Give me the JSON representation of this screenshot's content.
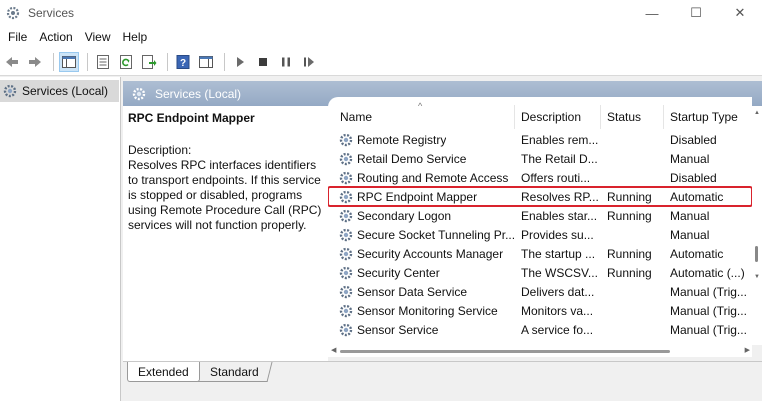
{
  "window": {
    "title": "Services",
    "controls": {
      "minimize": "—",
      "maximize": "☐",
      "close": "✕"
    }
  },
  "menu": [
    "File",
    "Action",
    "View",
    "Help"
  ],
  "toolbar": {
    "icons": [
      "back-arrow-icon",
      "forward-arrow-icon",
      "show-hide-console-tree-icon",
      "properties-icon",
      "refresh-icon",
      "export-list-icon",
      "help-icon",
      "action-pane-icon",
      "start-service-icon",
      "stop-service-icon",
      "pause-service-icon",
      "restart-service-icon"
    ]
  },
  "tree": {
    "item": "Services (Local)"
  },
  "pane": {
    "title": "Services (Local)"
  },
  "description": {
    "service_name": "RPC Endpoint Mapper",
    "label": "Description:",
    "text": "Resolves RPC interfaces identifiers to transport endpoints. If this service is stopped or disabled, programs using Remote Procedure Call (RPC) services will not function properly."
  },
  "list": {
    "columns": {
      "name": "Name",
      "description": "Description",
      "status": "Status",
      "startup": "Startup Type"
    },
    "sort_arrow": "^",
    "rows": [
      {
        "name": "Remote Registry",
        "description": "Enables rem...",
        "status": "",
        "startup": "Disabled"
      },
      {
        "name": "Retail Demo Service",
        "description": "The Retail D...",
        "status": "",
        "startup": "Manual"
      },
      {
        "name": "Routing and Remote Access",
        "description": "Offers routi...",
        "status": "",
        "startup": "Disabled"
      },
      {
        "name": "RPC Endpoint Mapper",
        "description": "Resolves RP...",
        "status": "Running",
        "startup": "Automatic"
      },
      {
        "name": "Secondary Logon",
        "description": "Enables star...",
        "status": "Running",
        "startup": "Manual"
      },
      {
        "name": "Secure Socket Tunneling Pr...",
        "description": "Provides su...",
        "status": "",
        "startup": "Manual"
      },
      {
        "name": "Security Accounts Manager",
        "description": "The startup ...",
        "status": "Running",
        "startup": "Automatic"
      },
      {
        "name": "Security Center",
        "description": "The WSCSV...",
        "status": "Running",
        "startup": "Automatic (...)"
      },
      {
        "name": "Sensor Data Service",
        "description": "Delivers dat...",
        "status": "",
        "startup": "Manual (Trig..."
      },
      {
        "name": "Sensor Monitoring Service",
        "description": "Monitors va...",
        "status": "",
        "startup": "Manual (Trig..."
      },
      {
        "name": "Sensor Service",
        "description": "A service fo...",
        "status": "",
        "startup": "Manual (Trig..."
      }
    ],
    "highlight_color": "#d9232d"
  },
  "tabs": {
    "extended": "Extended",
    "standard": "Standard"
  }
}
